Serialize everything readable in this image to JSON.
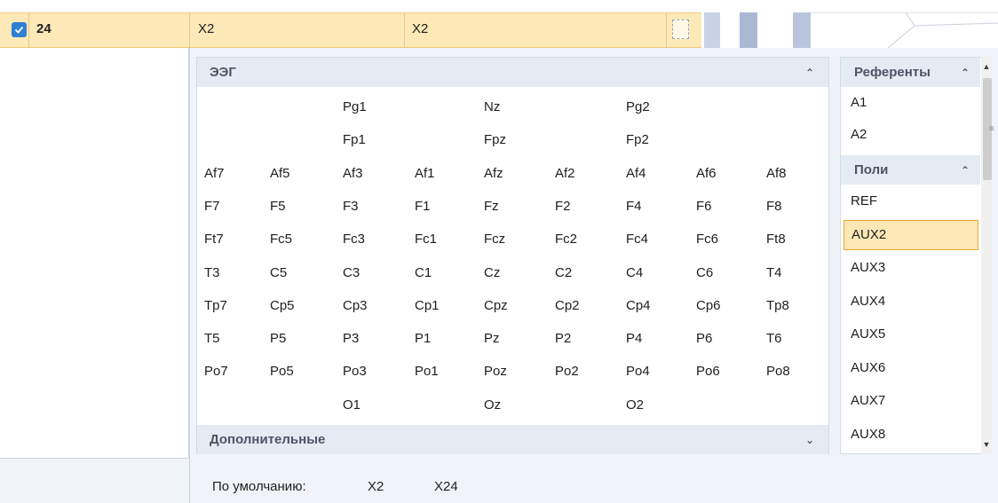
{
  "row": {
    "number": "24",
    "ref_a": "X2",
    "ref_b": "X2",
    "checked": true
  },
  "eeg": {
    "header": "ЭЭГ",
    "cells": [
      {
        "label": "Pg1",
        "row": 0,
        "col": 2
      },
      {
        "label": "Nz",
        "row": 0,
        "col": 4
      },
      {
        "label": "Pg2",
        "row": 0,
        "col": 6
      },
      {
        "label": "Fp1",
        "row": 1,
        "col": 2
      },
      {
        "label": "Fpz",
        "row": 1,
        "col": 4
      },
      {
        "label": "Fp2",
        "row": 1,
        "col": 6
      },
      {
        "label": "Af7",
        "row": 2,
        "col": 0
      },
      {
        "label": "Af5",
        "row": 2,
        "col": 1
      },
      {
        "label": "Af3",
        "row": 2,
        "col": 2
      },
      {
        "label": "Af1",
        "row": 2,
        "col": 3
      },
      {
        "label": "Afz",
        "row": 2,
        "col": 4
      },
      {
        "label": "Af2",
        "row": 2,
        "col": 5
      },
      {
        "label": "Af4",
        "row": 2,
        "col": 6
      },
      {
        "label": "Af6",
        "row": 2,
        "col": 7
      },
      {
        "label": "Af8",
        "row": 2,
        "col": 8
      },
      {
        "label": "F7",
        "row": 3,
        "col": 0
      },
      {
        "label": "F5",
        "row": 3,
        "col": 1
      },
      {
        "label": "F3",
        "row": 3,
        "col": 2
      },
      {
        "label": "F1",
        "row": 3,
        "col": 3
      },
      {
        "label": "Fz",
        "row": 3,
        "col": 4
      },
      {
        "label": "F2",
        "row": 3,
        "col": 5
      },
      {
        "label": "F4",
        "row": 3,
        "col": 6
      },
      {
        "label": "F6",
        "row": 3,
        "col": 7
      },
      {
        "label": "F8",
        "row": 3,
        "col": 8
      },
      {
        "label": "Ft7",
        "row": 4,
        "col": 0
      },
      {
        "label": "Fc5",
        "row": 4,
        "col": 1
      },
      {
        "label": "Fc3",
        "row": 4,
        "col": 2
      },
      {
        "label": "Fc1",
        "row": 4,
        "col": 3
      },
      {
        "label": "Fcz",
        "row": 4,
        "col": 4
      },
      {
        "label": "Fc2",
        "row": 4,
        "col": 5
      },
      {
        "label": "Fc4",
        "row": 4,
        "col": 6
      },
      {
        "label": "Fc6",
        "row": 4,
        "col": 7
      },
      {
        "label": "Ft8",
        "row": 4,
        "col": 8
      },
      {
        "label": "T3",
        "row": 5,
        "col": 0
      },
      {
        "label": "C5",
        "row": 5,
        "col": 1
      },
      {
        "label": "C3",
        "row": 5,
        "col": 2
      },
      {
        "label": "C1",
        "row": 5,
        "col": 3
      },
      {
        "label": "Cz",
        "row": 5,
        "col": 4
      },
      {
        "label": "C2",
        "row": 5,
        "col": 5
      },
      {
        "label": "C4",
        "row": 5,
        "col": 6
      },
      {
        "label": "C6",
        "row": 5,
        "col": 7
      },
      {
        "label": "T4",
        "row": 5,
        "col": 8
      },
      {
        "label": "Tp7",
        "row": 6,
        "col": 0
      },
      {
        "label": "Cp5",
        "row": 6,
        "col": 1
      },
      {
        "label": "Cp3",
        "row": 6,
        "col": 2
      },
      {
        "label": "Cp1",
        "row": 6,
        "col": 3
      },
      {
        "label": "Cpz",
        "row": 6,
        "col": 4
      },
      {
        "label": "Cp2",
        "row": 6,
        "col": 5
      },
      {
        "label": "Cp4",
        "row": 6,
        "col": 6
      },
      {
        "label": "Cp6",
        "row": 6,
        "col": 7
      },
      {
        "label": "Tp8",
        "row": 6,
        "col": 8
      },
      {
        "label": "T5",
        "row": 7,
        "col": 0
      },
      {
        "label": "P5",
        "row": 7,
        "col": 1
      },
      {
        "label": "P3",
        "row": 7,
        "col": 2
      },
      {
        "label": "P1",
        "row": 7,
        "col": 3
      },
      {
        "label": "Pz",
        "row": 7,
        "col": 4
      },
      {
        "label": "P2",
        "row": 7,
        "col": 5
      },
      {
        "label": "P4",
        "row": 7,
        "col": 6
      },
      {
        "label": "P6",
        "row": 7,
        "col": 7
      },
      {
        "label": "T6",
        "row": 7,
        "col": 8
      },
      {
        "label": "Po7",
        "row": 8,
        "col": 0
      },
      {
        "label": "Po5",
        "row": 8,
        "col": 1
      },
      {
        "label": "Po3",
        "row": 8,
        "col": 2
      },
      {
        "label": "Po1",
        "row": 8,
        "col": 3
      },
      {
        "label": "Poz",
        "row": 8,
        "col": 4
      },
      {
        "label": "Po2",
        "row": 8,
        "col": 5
      },
      {
        "label": "Po4",
        "row": 8,
        "col": 6
      },
      {
        "label": "Po6",
        "row": 8,
        "col": 7
      },
      {
        "label": "Po8",
        "row": 8,
        "col": 8
      },
      {
        "label": "O1",
        "row": 9,
        "col": 2
      },
      {
        "label": "Oz",
        "row": 9,
        "col": 4
      },
      {
        "label": "O2",
        "row": 9,
        "col": 6
      }
    ]
  },
  "extra": {
    "header": "Дополнительные"
  },
  "referents": {
    "header": "Референты",
    "items": [
      "A1",
      "A2"
    ]
  },
  "poly": {
    "header": "Поли",
    "items": [
      "REF",
      "AUX2",
      "AUX3",
      "AUX4",
      "AUX5",
      "AUX6",
      "AUX7",
      "AUX8"
    ],
    "selected": "AUX2"
  },
  "default": {
    "label": "По умолчанию:",
    "value1": "X2",
    "value2": "X24"
  },
  "colors": {
    "selected_row": "#fde8b7",
    "selected_border": "#e9a92d",
    "header_bg": "#e5ebf3",
    "checkbox": "#2f7fd6"
  }
}
